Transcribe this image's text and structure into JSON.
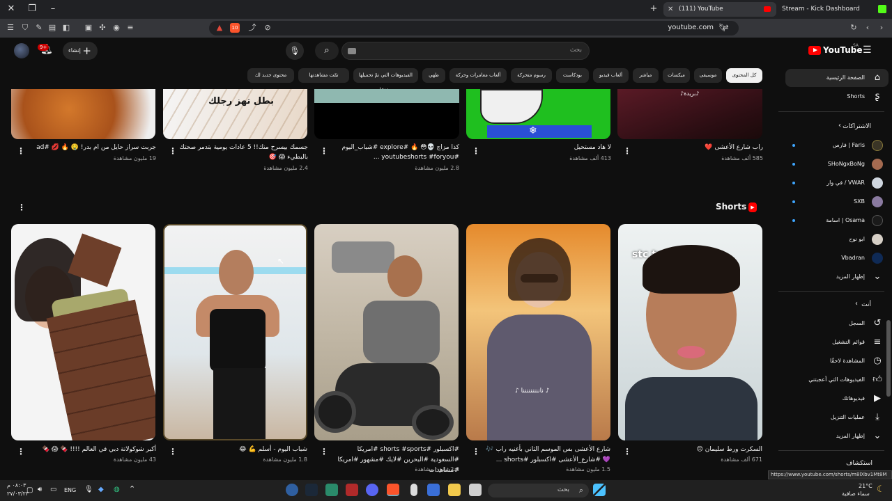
{
  "browser": {
    "tabs": [
      {
        "title": "(111) YouTube",
        "active": true
      },
      {
        "title": "Stream - Kick Dashboard",
        "active": false
      }
    ],
    "url": "youtube.com",
    "shield_badge": "10"
  },
  "header": {
    "logo_text": "YouTube",
    "country": "SA",
    "search_placeholder": "بحث",
    "create_label": "إنشاء",
    "notifications_badge": "9+"
  },
  "chips": [
    {
      "label": "كل المحتوى",
      "selected": true
    },
    {
      "label": "موسيقى"
    },
    {
      "label": "ميكسات"
    },
    {
      "label": "مباشر"
    },
    {
      "label": "ألعاب فيديو"
    },
    {
      "label": "بودكاست"
    },
    {
      "label": "رسوم متحركة"
    },
    {
      "label": "ألعاب مغامرات وحركة"
    },
    {
      "label": "طهي"
    },
    {
      "label": "الفيديوهات التي تمّ تحميلها مؤخرًا"
    },
    {
      "label": "تمّت مشاهدتها"
    },
    {
      "label": "محتوى جديد لك"
    }
  ],
  "sidebar": {
    "home": "الصفحة الرئيسية",
    "shorts": "Shorts",
    "subscriptions_head": "الاشتراكات",
    "subscriptions": [
      {
        "name": "فارس | Faris",
        "dot": true
      },
      {
        "name": "SHoNgxBoNg",
        "dot": true
      },
      {
        "name": "في وار / VWAR",
        "dot": true
      },
      {
        "name": "SXB",
        "dot": true
      },
      {
        "name": "اسامة | Osama",
        "dot": true
      },
      {
        "name": "ابو نوح",
        "dot": false
      },
      {
        "name": "Vbadran",
        "dot": false
      }
    ],
    "show_more": "إظهار المزيد",
    "you_head": "أنت",
    "you_items": [
      {
        "label": "السجل",
        "icon": "history-icon"
      },
      {
        "label": "قوائم التشغيل",
        "icon": "playlists-icon"
      },
      {
        "label": "المشاهدة لاحقًا",
        "icon": "watch-later-icon"
      },
      {
        "label": "الفيديوهات التي أعجبتني",
        "icon": "like-icon"
      },
      {
        "label": "فيديوهاتك",
        "icon": "your-videos-icon"
      },
      {
        "label": "عمليات التنزيل",
        "icon": "download-icon"
      },
      {
        "label": "إظهار المزيد",
        "icon": "chevron-down-icon"
      }
    ],
    "explore_head": "استكشاف"
  },
  "videos_top": [
    {
      "title": "راب شارع الأعشى ❤️",
      "meta": "585 ألف مشاهدة",
      "overlay": "♪بريدة♪"
    },
    {
      "title": "لا هاد مستحيل",
      "meta": "413 ألف مشاهدة"
    },
    {
      "title": "كذا مزاج 💀😳 🔥 #explore #شباب_اليوم #youtubeshorts #foryou ...",
      "meta": "2.8 مليون مشاهدة"
    },
    {
      "title": "جسمك بيسرح منك!! 5 عادات يومية بتدمر صحتك بالبطيء 😱 🎯",
      "meta": "2.4 مليون مشاهدة",
      "overlay": "بطل تهز رجلك"
    },
    {
      "title": "جربت سراز حايل من ام بدر! 🤤 🔥 💋 #ad",
      "meta": "19 مليون مشاهدة"
    }
  ],
  "shorts": {
    "heading": "Shorts",
    "items": [
      {
        "title": "السكرت ورط سليمان 😔",
        "meta": "671 ألف مشاهدة",
        "overlay": "stc tv"
      },
      {
        "title": "شارع الأعشى بس الموسم الثاني بأغنيه راب 🎶 💜 #شارع_الأعشى #اكسبلور #shorts ...",
        "meta": "1.5 مليون مشاهدة",
        "overlay": "♪ نانننننننننا ♪"
      },
      {
        "title": "#اكسبلور #shorts #sports #امريكا #السعودية #البحرين #لايك #مشهور #امريكا #مشاهدات",
        "meta": "2.4 مليون مشاهدة"
      },
      {
        "title": "شباب اليوم - أسلم 💪 😂",
        "meta": "1.8 مليون مشاهدة"
      },
      {
        "title": "أكبر شوكولاتة دبي في العالم !!!! 🍫 😱 🍫",
        "meta": "43 مليون مشاهدة"
      }
    ]
  },
  "status_url": "https://www.youtube.com/shorts/m8lXbv1Mt8M",
  "taskbar": {
    "search_text": "بحث",
    "weather_temp": "21°C",
    "weather_desc": "سماء صافية",
    "time": "٠٨:٠٣ م",
    "date": "٢٧/٠٣/٢٣",
    "lang": "ENG"
  },
  "colors": {
    "background": "#0f0f0f",
    "youtube_red": "#ff0000",
    "chip_bg": "#272727",
    "subscription_dot": "#3ea6ff"
  }
}
